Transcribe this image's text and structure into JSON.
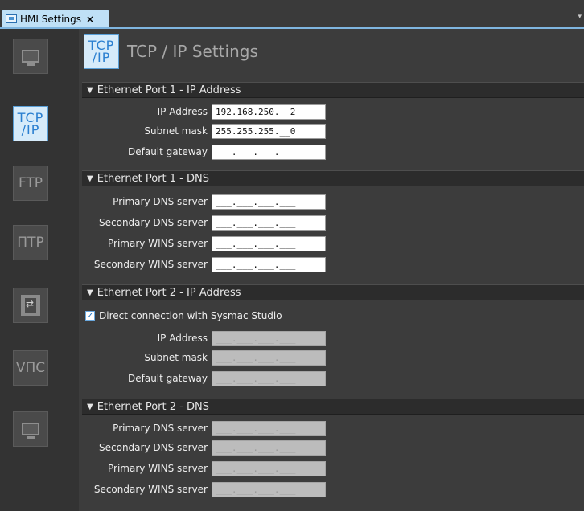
{
  "tab": {
    "label": "HMI Settings",
    "close": "×"
  },
  "overflow": "▾",
  "sidebar": {
    "items": [
      {
        "name": "monitor"
      },
      {
        "name": "tcp-ip",
        "label_top": "TCP",
        "label_bottom": "/IP"
      },
      {
        "name": "ftp",
        "label": "FTP"
      },
      {
        "name": "ntp",
        "label": "ΠTP"
      },
      {
        "name": "transfer"
      },
      {
        "name": "vnc",
        "label": "VПC"
      },
      {
        "name": "monitor2"
      }
    ]
  },
  "header": {
    "icon_top": "TCP",
    "icon_bottom": "/IP",
    "title": "TCP / IP Settings"
  },
  "sections": {
    "eth1_ip": {
      "title": "Ethernet Port 1 - IP Address",
      "ip_label": "IP Address",
      "ip_value": "192.168.250.__2",
      "subnet_label": "Subnet mask",
      "subnet_value": "255.255.255.__0",
      "gateway_label": "Default gateway",
      "gateway_value": "___.___.___.___"
    },
    "eth1_dns": {
      "title": "Ethernet Port 1 - DNS",
      "primary_dns_label": "Primary DNS server",
      "primary_dns_value": "___.___.___.___",
      "secondary_dns_label": "Secondary DNS server",
      "secondary_dns_value": "___.___.___.___",
      "primary_wins_label": "Primary WINS server",
      "primary_wins_value": "___.___.___.___",
      "secondary_wins_label": "Secondary WINS server",
      "secondary_wins_value": "___.___.___.___"
    },
    "eth2_ip": {
      "title": "Ethernet Port 2 - IP Address",
      "direct_label": "Direct connection with Sysmac Studio",
      "direct_checked": true,
      "ip_label": "IP Address",
      "ip_value": "___.___.___.___",
      "subnet_label": "Subnet mask",
      "subnet_value": "___.___.___.___",
      "gateway_label": "Default gateway",
      "gateway_value": "___.___.___.___"
    },
    "eth2_dns": {
      "title": "Ethernet Port 2 - DNS",
      "primary_dns_label": "Primary DNS server",
      "primary_dns_value": "___.___.___.___",
      "secondary_dns_label": "Secondary DNS server",
      "secondary_dns_value": "___.___.___.___",
      "primary_wins_label": "Primary WINS server",
      "primary_wins_value": "___.___.___.___",
      "secondary_wins_label": "Secondary WINS server",
      "secondary_wins_value": "___.___.___.___"
    }
  },
  "colors": {
    "accent": "#2a7fd0",
    "tab_bg": "#bfe0f6",
    "panel_bg": "#3c3c3c"
  }
}
